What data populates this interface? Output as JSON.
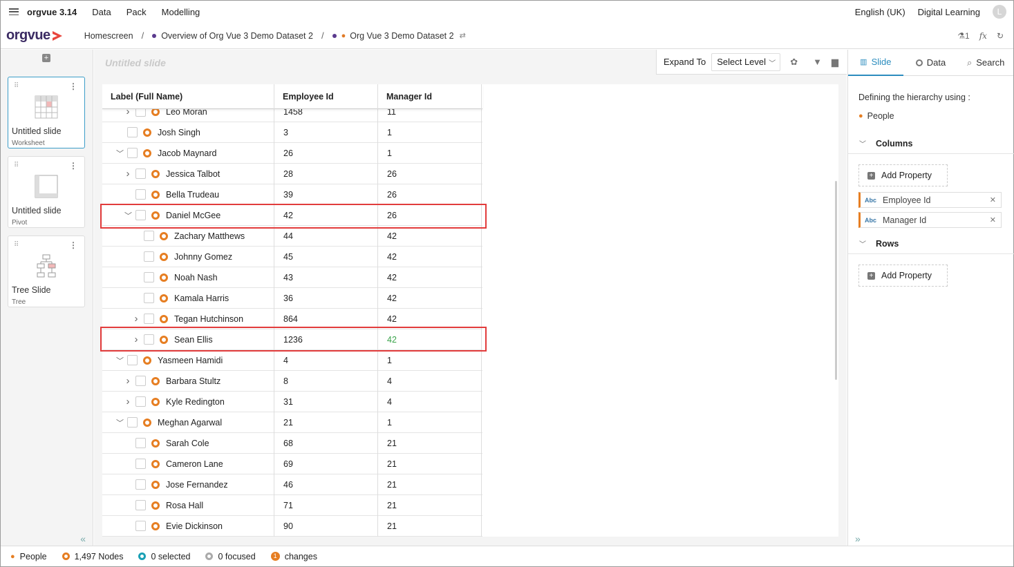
{
  "app": {
    "name": "orgvue 3.14",
    "menu": [
      "Data",
      "Pack",
      "Modelling"
    ],
    "language": "English (UK)",
    "digital_learning": "Digital Learning",
    "avatar_initial": "L"
  },
  "breadcrumb": {
    "logo": "orgvue",
    "home": "Homescreen",
    "overview": "Overview of Org Vue 3 Demo Dataset 2",
    "dataset": "Org Vue 3 Demo Dataset 2",
    "right_count": "1",
    "fx": "fx"
  },
  "slides": [
    {
      "title": "Untitled slide",
      "type": "Worksheet",
      "active": true
    },
    {
      "title": "Untitled slide",
      "type": "Pivot",
      "active": false
    },
    {
      "title": "Tree Slide",
      "type": "Tree",
      "active": false
    }
  ],
  "main": {
    "slide_title": "Untitled slide",
    "toolbar": {
      "expand_label": "Expand To",
      "select_level": "Select Level"
    },
    "columns": [
      "Label (Full Name)",
      "Employee Id",
      "Manager Id"
    ],
    "rows": [
      {
        "name": "Leo Moran",
        "emp": "1458",
        "mgr": "11",
        "level": 2,
        "expander": "right"
      },
      {
        "name": "Josh Singh",
        "emp": "3",
        "mgr": "1",
        "level": 1,
        "expander": ""
      },
      {
        "name": "Jacob Maynard",
        "emp": "26",
        "mgr": "1",
        "level": 1,
        "expander": "down"
      },
      {
        "name": "Jessica Talbot",
        "emp": "28",
        "mgr": "26",
        "level": 2,
        "expander": "right"
      },
      {
        "name": "Bella Trudeau",
        "emp": "39",
        "mgr": "26",
        "level": 2,
        "expander": ""
      },
      {
        "name": "Daniel McGee",
        "emp": "42",
        "mgr": "26",
        "level": 2,
        "expander": "down"
      },
      {
        "name": "Zachary Matthews",
        "emp": "44",
        "mgr": "42",
        "level": 3,
        "expander": ""
      },
      {
        "name": "Johnny Gomez",
        "emp": "45",
        "mgr": "42",
        "level": 3,
        "expander": ""
      },
      {
        "name": "Noah Nash",
        "emp": "43",
        "mgr": "42",
        "level": 3,
        "expander": ""
      },
      {
        "name": "Kamala Harris",
        "emp": "36",
        "mgr": "42",
        "level": 3,
        "expander": ""
      },
      {
        "name": "Tegan Hutchinson",
        "emp": "864",
        "mgr": "42",
        "level": 3,
        "expander": "right"
      },
      {
        "name": "Sean Ellis",
        "emp": "1236",
        "mgr": "42",
        "level": 3,
        "expander": "right",
        "changed": true
      },
      {
        "name": "Yasmeen Hamidi",
        "emp": "4",
        "mgr": "1",
        "level": 1,
        "expander": "down"
      },
      {
        "name": "Barbara Stultz",
        "emp": "8",
        "mgr": "4",
        "level": 2,
        "expander": "right"
      },
      {
        "name": "Kyle Redington",
        "emp": "31",
        "mgr": "4",
        "level": 2,
        "expander": "right"
      },
      {
        "name": "Meghan Agarwal",
        "emp": "21",
        "mgr": "1",
        "level": 1,
        "expander": "down"
      },
      {
        "name": "Sarah Cole",
        "emp": "68",
        "mgr": "21",
        "level": 2,
        "expander": ""
      },
      {
        "name": "Cameron Lane",
        "emp": "69",
        "mgr": "21",
        "level": 2,
        "expander": ""
      },
      {
        "name": "Jose Fernandez",
        "emp": "46",
        "mgr": "21",
        "level": 2,
        "expander": ""
      },
      {
        "name": "Rosa Hall",
        "emp": "71",
        "mgr": "21",
        "level": 2,
        "expander": ""
      },
      {
        "name": "Evie Dickinson",
        "emp": "90",
        "mgr": "21",
        "level": 2,
        "expander": ""
      }
    ]
  },
  "panel": {
    "tabs": [
      "Slide",
      "Data",
      "Search"
    ],
    "hierarchy_label": "Defining the hierarchy using :",
    "hierarchy_value": "People",
    "columns_label": "Columns",
    "rows_label": "Rows",
    "add_property": "Add Property",
    "abc": "Abc",
    "properties": [
      "Employee Id",
      "Manager Id"
    ]
  },
  "status": {
    "dataset": "People",
    "nodes": "1,497 Nodes",
    "selected": "0 selected",
    "focused": "0 focused",
    "changes_count": "1",
    "changes": "changes"
  },
  "colors": {
    "accent": "#2b8cbe",
    "node": "#e67e22",
    "highlight": "#e23b3b",
    "changed": "#3aa34a"
  }
}
